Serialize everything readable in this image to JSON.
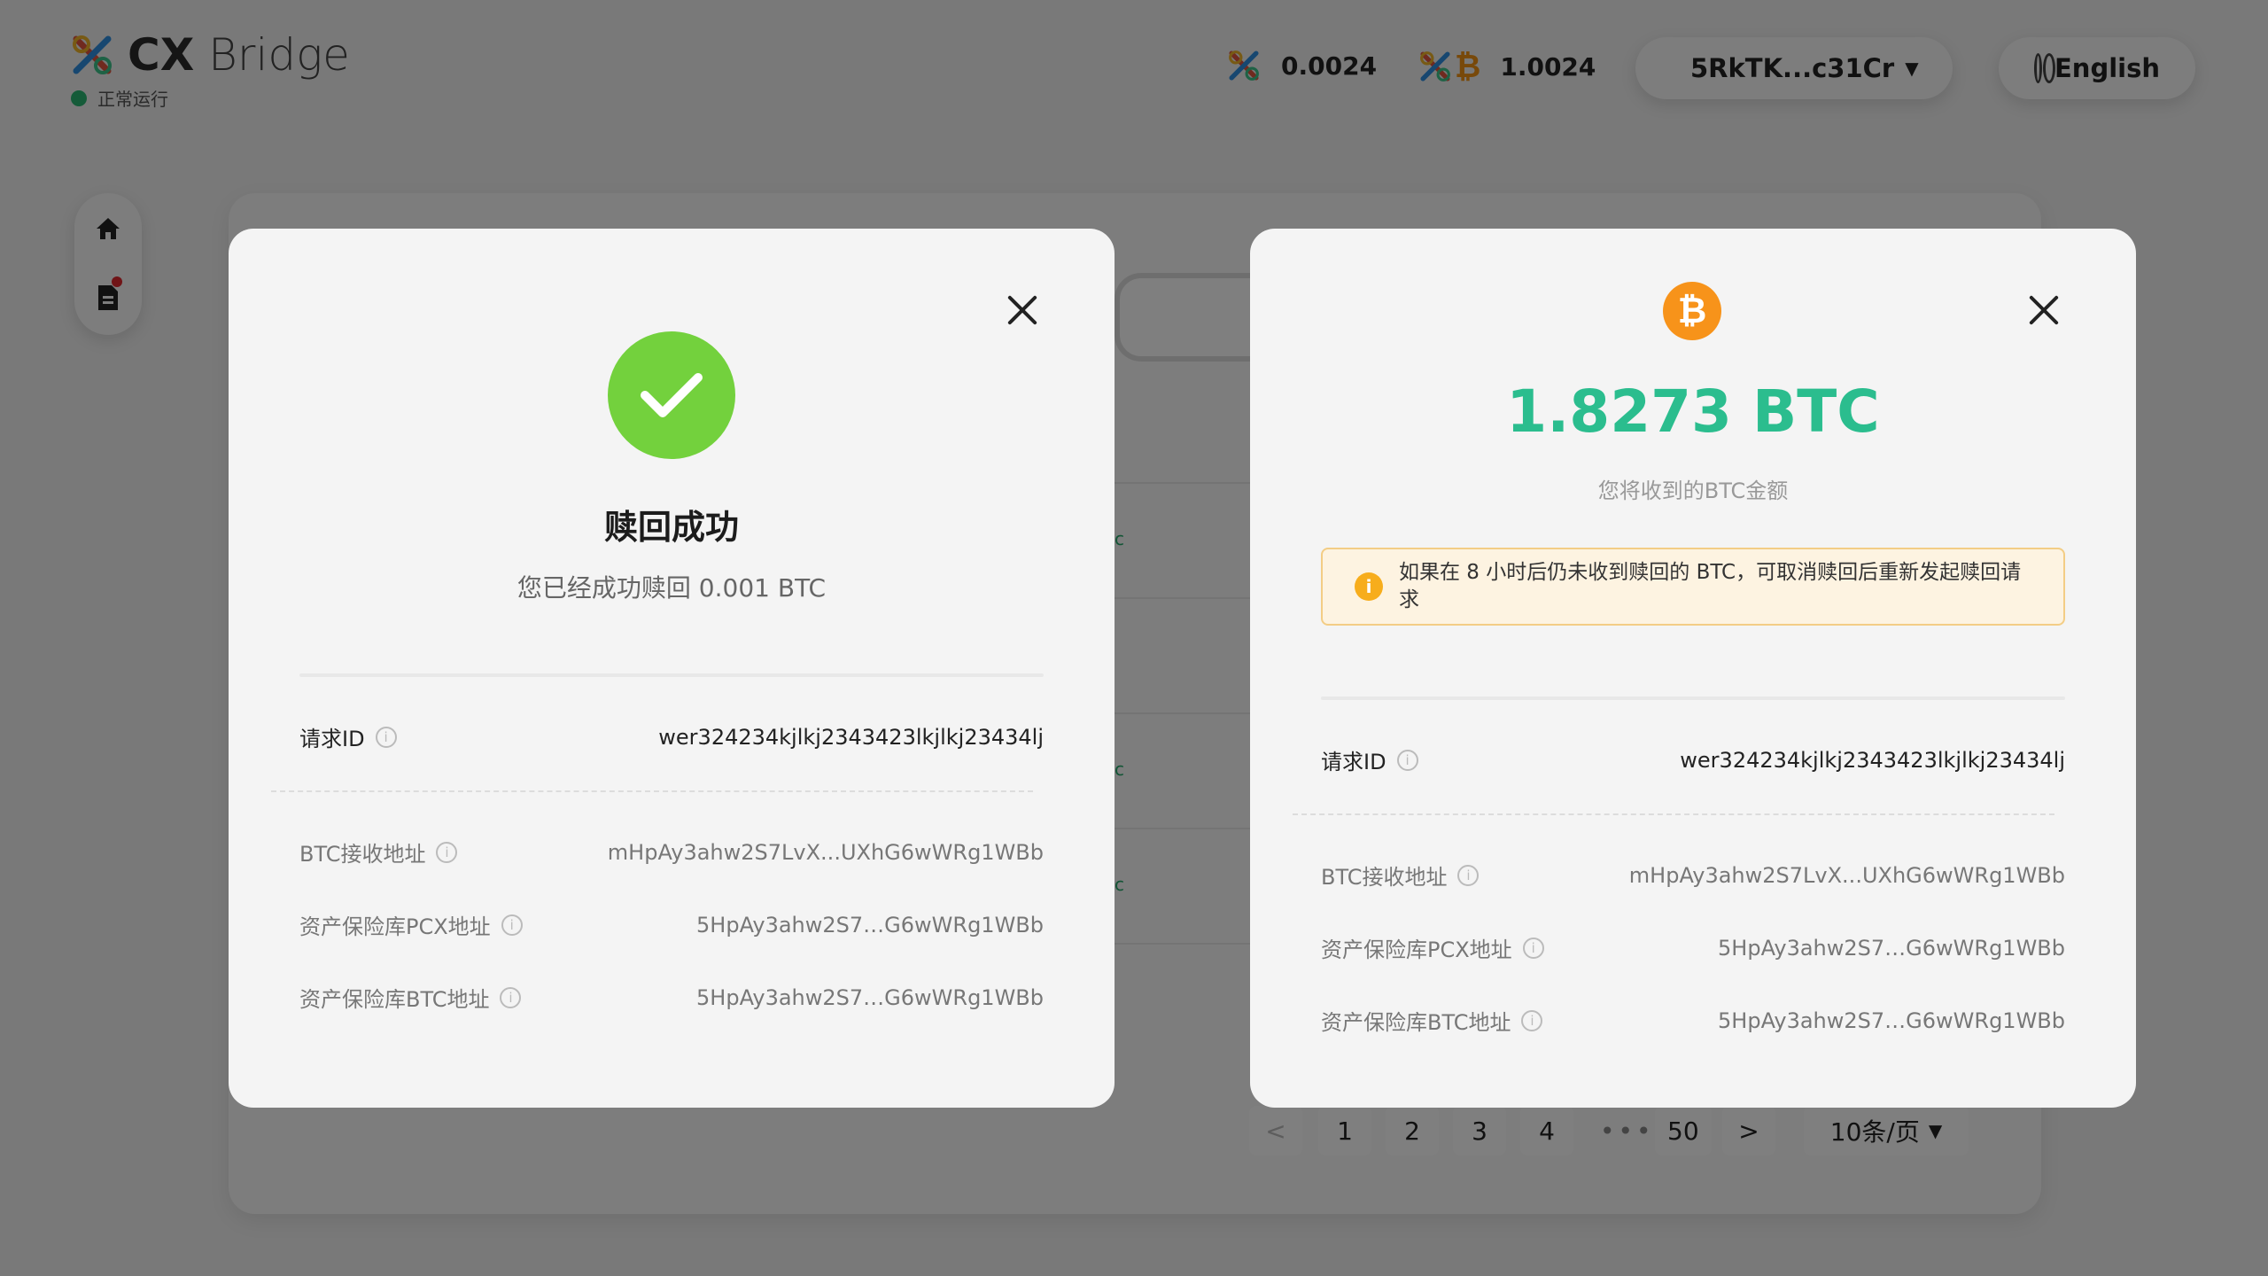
{
  "header": {
    "logo_bold": "CX",
    "logo_light": " Bridge",
    "status_text": "正常运行",
    "balance_pcx": "0.0024",
    "balance_xbtc": "1.0024",
    "account_label": "5RkTK...c31Cr",
    "language_label": "English"
  },
  "background": {
    "pagination": [
      "<",
      "1",
      "2",
      "3",
      "4",
      "•••",
      "50",
      ">"
    ],
    "page_size": "10条/页",
    "row_marker": "c"
  },
  "success_modal": {
    "title": "赎回成功",
    "subtitle": "您已经成功赎回 0.001 BTC",
    "rows": [
      {
        "label": "请求ID",
        "value": "wer324234kjlkj2343423lkjlkj23434lj"
      },
      {
        "label": "BTC接收地址",
        "value": "mHpAy3ahw2S7LvX...UXhG6wWRg1WBb"
      },
      {
        "label": "资产保险库PCX地址",
        "value": "5HpAy3ahw2S7…G6wWRg1WBb"
      },
      {
        "label": "资产保险库BTC地址",
        "value": "5HpAy3ahw2S7…G6wWRg1WBb"
      }
    ]
  },
  "btc_modal": {
    "coin_symbol": "₿",
    "amount": "1.8273 BTC",
    "amount_label": "您将收到的BTC金额",
    "warning": "如果在 8 小时后仍未收到赎回的 BTC，可取消赎回后重新发起赎回请求",
    "rows": [
      {
        "label": "请求ID",
        "value": "wer324234kjlkj2343423lkjlkj23434lj"
      },
      {
        "label": "BTC接收地址",
        "value": "mHpAy3ahw2S7LvX...UXhG6wWRg1WBb"
      },
      {
        "label": "资产保险库PCX地址",
        "value": "5HpAy3ahw2S7…G6wWRg1WBb"
      },
      {
        "label": "资产保险库BTC地址",
        "value": "5HpAy3ahw2S7…G6wWRg1WBb"
      }
    ]
  },
  "colors": {
    "success": "#73d13d",
    "amount": "#2bbd8e",
    "bitcoin": "#f7931a",
    "warning_bg": "#fdf3e1",
    "warning_border": "#f3cd85"
  }
}
